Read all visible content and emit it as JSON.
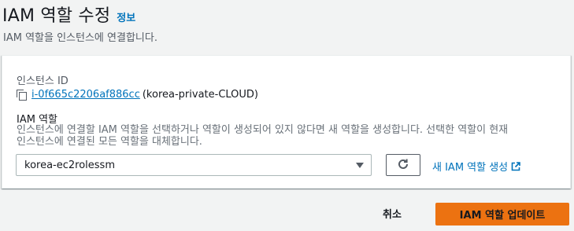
{
  "header": {
    "title": "IAM 역할 수정",
    "info_link": "정보",
    "subtitle": "IAM 역할을 인스턴스에 연결합니다."
  },
  "panel": {
    "instance_label": "인스턴스 ID",
    "instance_id": "i-0f665c2206af886cc",
    "instance_name": "(korea-private-CLOUD)",
    "role_label": "IAM 역할",
    "role_description": "인스턴스에 연결할 IAM 역할을 선택하거나 역할이 생성되어 있지 않다면 새 역할을 생성합니다. 선택한 역할이 현재 인스턴스에 연결된 모든 역할을 대체합니다.",
    "role_select_value": "korea-ec2rolessm",
    "new_role_link": "새 IAM 역할 생성"
  },
  "footer": {
    "cancel_label": "취소",
    "submit_label": "IAM 역할 업데이트"
  },
  "colors": {
    "link": "#0073bb",
    "primary": "#ec7211",
    "background": "#f2f3f3"
  },
  "icons": {
    "copy": "copy-icon",
    "caret": "caret-down-icon",
    "refresh": "refresh-icon",
    "external": "external-link-icon"
  }
}
